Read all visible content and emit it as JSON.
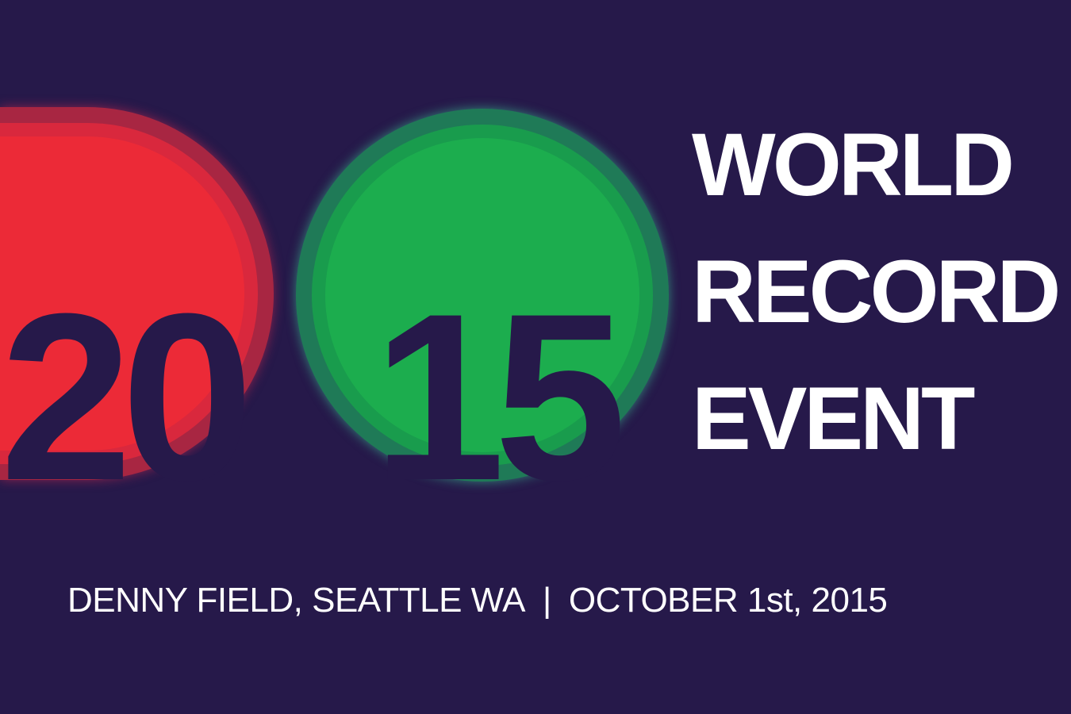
{
  "year": {
    "part1": "20",
    "part2": "15"
  },
  "title": {
    "line1": "WORLD",
    "line2": "RECORD",
    "line3": "EVENT"
  },
  "footer": {
    "location": "DENNY FIELD, SEATTLE WA",
    "separator": "|",
    "date": "OCTOBER 1st, 2015"
  },
  "colors": {
    "background": "#26194a",
    "red": "#ec2a37",
    "green": "#1cad4e",
    "text": "#ffffff"
  }
}
